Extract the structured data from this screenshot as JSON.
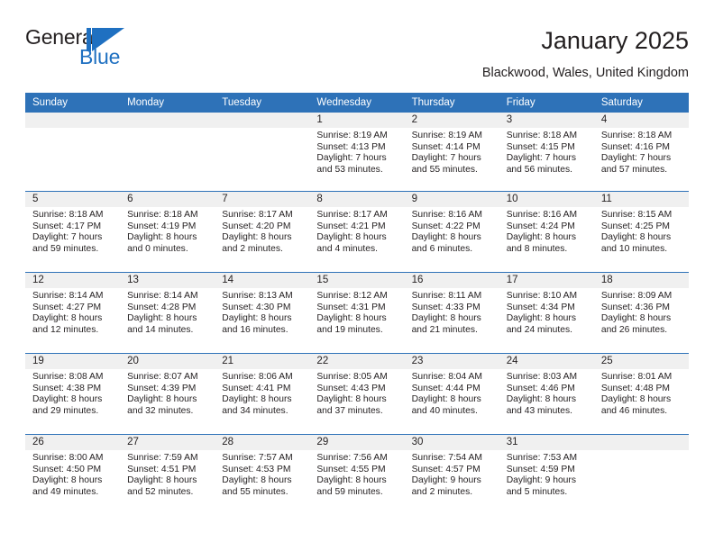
{
  "brand": {
    "name_part1": "General",
    "name_part2": "Blue",
    "accent_color": "#1f70c1"
  },
  "header": {
    "title": "January 2025",
    "subtitle": "Blackwood, Wales, United Kingdom",
    "header_color": "#2e72b8"
  },
  "weekdays": [
    "Sunday",
    "Monday",
    "Tuesday",
    "Wednesday",
    "Thursday",
    "Friday",
    "Saturday"
  ],
  "weeks": [
    [
      {
        "day": ""
      },
      {
        "day": ""
      },
      {
        "day": ""
      },
      {
        "day": "1",
        "sunrise": "Sunrise: 8:19 AM",
        "sunset": "Sunset: 4:13 PM",
        "daylight1": "Daylight: 7 hours",
        "daylight2": "and 53 minutes."
      },
      {
        "day": "2",
        "sunrise": "Sunrise: 8:19 AM",
        "sunset": "Sunset: 4:14 PM",
        "daylight1": "Daylight: 7 hours",
        "daylight2": "and 55 minutes."
      },
      {
        "day": "3",
        "sunrise": "Sunrise: 8:18 AM",
        "sunset": "Sunset: 4:15 PM",
        "daylight1": "Daylight: 7 hours",
        "daylight2": "and 56 minutes."
      },
      {
        "day": "4",
        "sunrise": "Sunrise: 8:18 AM",
        "sunset": "Sunset: 4:16 PM",
        "daylight1": "Daylight: 7 hours",
        "daylight2": "and 57 minutes."
      }
    ],
    [
      {
        "day": "5",
        "sunrise": "Sunrise: 8:18 AM",
        "sunset": "Sunset: 4:17 PM",
        "daylight1": "Daylight: 7 hours",
        "daylight2": "and 59 minutes."
      },
      {
        "day": "6",
        "sunrise": "Sunrise: 8:18 AM",
        "sunset": "Sunset: 4:19 PM",
        "daylight1": "Daylight: 8 hours",
        "daylight2": "and 0 minutes."
      },
      {
        "day": "7",
        "sunrise": "Sunrise: 8:17 AM",
        "sunset": "Sunset: 4:20 PM",
        "daylight1": "Daylight: 8 hours",
        "daylight2": "and 2 minutes."
      },
      {
        "day": "8",
        "sunrise": "Sunrise: 8:17 AM",
        "sunset": "Sunset: 4:21 PM",
        "daylight1": "Daylight: 8 hours",
        "daylight2": "and 4 minutes."
      },
      {
        "day": "9",
        "sunrise": "Sunrise: 8:16 AM",
        "sunset": "Sunset: 4:22 PM",
        "daylight1": "Daylight: 8 hours",
        "daylight2": "and 6 minutes."
      },
      {
        "day": "10",
        "sunrise": "Sunrise: 8:16 AM",
        "sunset": "Sunset: 4:24 PM",
        "daylight1": "Daylight: 8 hours",
        "daylight2": "and 8 minutes."
      },
      {
        "day": "11",
        "sunrise": "Sunrise: 8:15 AM",
        "sunset": "Sunset: 4:25 PM",
        "daylight1": "Daylight: 8 hours",
        "daylight2": "and 10 minutes."
      }
    ],
    [
      {
        "day": "12",
        "sunrise": "Sunrise: 8:14 AM",
        "sunset": "Sunset: 4:27 PM",
        "daylight1": "Daylight: 8 hours",
        "daylight2": "and 12 minutes."
      },
      {
        "day": "13",
        "sunrise": "Sunrise: 8:14 AM",
        "sunset": "Sunset: 4:28 PM",
        "daylight1": "Daylight: 8 hours",
        "daylight2": "and 14 minutes."
      },
      {
        "day": "14",
        "sunrise": "Sunrise: 8:13 AM",
        "sunset": "Sunset: 4:30 PM",
        "daylight1": "Daylight: 8 hours",
        "daylight2": "and 16 minutes."
      },
      {
        "day": "15",
        "sunrise": "Sunrise: 8:12 AM",
        "sunset": "Sunset: 4:31 PM",
        "daylight1": "Daylight: 8 hours",
        "daylight2": "and 19 minutes."
      },
      {
        "day": "16",
        "sunrise": "Sunrise: 8:11 AM",
        "sunset": "Sunset: 4:33 PM",
        "daylight1": "Daylight: 8 hours",
        "daylight2": "and 21 minutes."
      },
      {
        "day": "17",
        "sunrise": "Sunrise: 8:10 AM",
        "sunset": "Sunset: 4:34 PM",
        "daylight1": "Daylight: 8 hours",
        "daylight2": "and 24 minutes."
      },
      {
        "day": "18",
        "sunrise": "Sunrise: 8:09 AM",
        "sunset": "Sunset: 4:36 PM",
        "daylight1": "Daylight: 8 hours",
        "daylight2": "and 26 minutes."
      }
    ],
    [
      {
        "day": "19",
        "sunrise": "Sunrise: 8:08 AM",
        "sunset": "Sunset: 4:38 PM",
        "daylight1": "Daylight: 8 hours",
        "daylight2": "and 29 minutes."
      },
      {
        "day": "20",
        "sunrise": "Sunrise: 8:07 AM",
        "sunset": "Sunset: 4:39 PM",
        "daylight1": "Daylight: 8 hours",
        "daylight2": "and 32 minutes."
      },
      {
        "day": "21",
        "sunrise": "Sunrise: 8:06 AM",
        "sunset": "Sunset: 4:41 PM",
        "daylight1": "Daylight: 8 hours",
        "daylight2": "and 34 minutes."
      },
      {
        "day": "22",
        "sunrise": "Sunrise: 8:05 AM",
        "sunset": "Sunset: 4:43 PM",
        "daylight1": "Daylight: 8 hours",
        "daylight2": "and 37 minutes."
      },
      {
        "day": "23",
        "sunrise": "Sunrise: 8:04 AM",
        "sunset": "Sunset: 4:44 PM",
        "daylight1": "Daylight: 8 hours",
        "daylight2": "and 40 minutes."
      },
      {
        "day": "24",
        "sunrise": "Sunrise: 8:03 AM",
        "sunset": "Sunset: 4:46 PM",
        "daylight1": "Daylight: 8 hours",
        "daylight2": "and 43 minutes."
      },
      {
        "day": "25",
        "sunrise": "Sunrise: 8:01 AM",
        "sunset": "Sunset: 4:48 PM",
        "daylight1": "Daylight: 8 hours",
        "daylight2": "and 46 minutes."
      }
    ],
    [
      {
        "day": "26",
        "sunrise": "Sunrise: 8:00 AM",
        "sunset": "Sunset: 4:50 PM",
        "daylight1": "Daylight: 8 hours",
        "daylight2": "and 49 minutes."
      },
      {
        "day": "27",
        "sunrise": "Sunrise: 7:59 AM",
        "sunset": "Sunset: 4:51 PM",
        "daylight1": "Daylight: 8 hours",
        "daylight2": "and 52 minutes."
      },
      {
        "day": "28",
        "sunrise": "Sunrise: 7:57 AM",
        "sunset": "Sunset: 4:53 PM",
        "daylight1": "Daylight: 8 hours",
        "daylight2": "and 55 minutes."
      },
      {
        "day": "29",
        "sunrise": "Sunrise: 7:56 AM",
        "sunset": "Sunset: 4:55 PM",
        "daylight1": "Daylight: 8 hours",
        "daylight2": "and 59 minutes."
      },
      {
        "day": "30",
        "sunrise": "Sunrise: 7:54 AM",
        "sunset": "Sunset: 4:57 PM",
        "daylight1": "Daylight: 9 hours",
        "daylight2": "and 2 minutes."
      },
      {
        "day": "31",
        "sunrise": "Sunrise: 7:53 AM",
        "sunset": "Sunset: 4:59 PM",
        "daylight1": "Daylight: 9 hours",
        "daylight2": "and 5 minutes."
      },
      {
        "day": ""
      }
    ]
  ]
}
